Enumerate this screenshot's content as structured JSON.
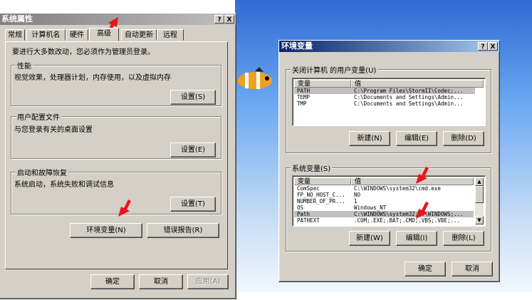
{
  "sys_props": {
    "title": "系统属性",
    "help_btn": "?",
    "close_btn": "X",
    "tabs": [
      "常规",
      "计算机名",
      "硬件",
      "高级",
      "自动更新",
      "远程"
    ],
    "notice": "要进行大多数改动，您必须作为管理员登录。",
    "performance": {
      "label": "性能",
      "desc": "视觉效果，处理器计划，内存使用，以及虚拟内存",
      "button": "设置(S)"
    },
    "profiles": {
      "label": "用户配置文件",
      "desc": "与您登录有关的桌面设置",
      "button": "设置(E)"
    },
    "startup": {
      "label": "启动和故障恢复",
      "desc": "系统启动，系统失败和调试信息",
      "button": "设置(T)"
    },
    "env_button": "环境变量(N)",
    "error_button": "错误报告(R)",
    "ok": "确定",
    "cancel": "取消",
    "apply": "应用(A)"
  },
  "env_vars": {
    "title": "环境变量",
    "help_btn": "?",
    "close_btn": "X",
    "user_group_label": "关闭计算机 的用户变量(U)",
    "columns": [
      "变量",
      "值"
    ],
    "user_vars": [
      {
        "name": "PATH",
        "value": "C:\\Program Files\\StormII\\Codec;..."
      },
      {
        "name": "TEMP",
        "value": "C:\\Documents and Settings\\Admin..."
      },
      {
        "name": "TMP",
        "value": "C:\\Documents and Settings\\Admin..."
      }
    ],
    "user_buttons": [
      "新建(N)",
      "编辑(E)",
      "删除(D)"
    ],
    "sys_group_label": "系统变量(S)",
    "sys_vars": [
      {
        "name": "ComSpec",
        "value": "C:\\WINDOWS\\system32\\cmd.exe"
      },
      {
        "name": "FP_NO_HOST_C...",
        "value": "NO"
      },
      {
        "name": "NUMBER_OF_PR...",
        "value": "1"
      },
      {
        "name": "OS",
        "value": "Windows_NT"
      },
      {
        "name": "Path",
        "value": "C:\\WINDOWS\\system32;C:\\WINDOWS;..."
      },
      {
        "name": "PATHEXT",
        "value": ".COM;.EXE;.BAT;.CMD;.VBS;.VBE;..."
      }
    ],
    "sys_buttons": [
      "新建(W)",
      "编辑(I)",
      "删除(L)"
    ],
    "ok": "确定",
    "cancel": "取消"
  },
  "colors": {
    "arrow": "#e8141a",
    "title_active": "#0a246a",
    "face": "#d4d0c8"
  }
}
